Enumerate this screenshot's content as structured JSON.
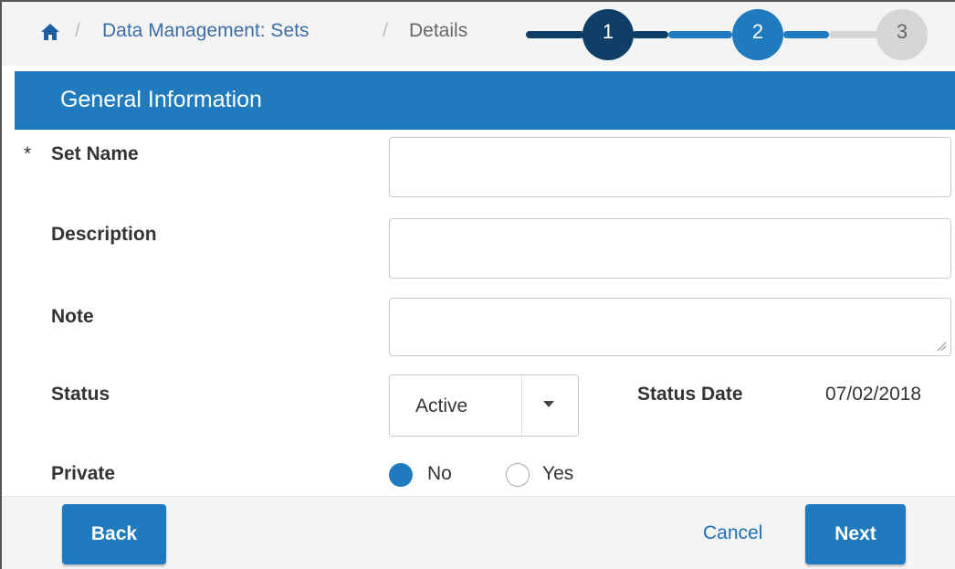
{
  "breadcrumb": {
    "items": [
      "Data Management: Sets",
      "Details"
    ],
    "separator": "/"
  },
  "stepper": {
    "steps": [
      "1",
      "2",
      "3"
    ],
    "current_step": 2,
    "colors": {
      "completed": "#0f3f66",
      "current": "#1f7bbd",
      "pending": "#d6d6d6"
    }
  },
  "section": {
    "title": "General Information"
  },
  "form": {
    "set_name": {
      "label": "Set Name",
      "required_mark": "*",
      "value": ""
    },
    "description": {
      "label": "Description",
      "value": ""
    },
    "note": {
      "label": "Note",
      "value": ""
    },
    "status": {
      "label": "Status",
      "selected": "Active"
    },
    "status_date": {
      "label": "Status Date",
      "value": "07/02/2018"
    },
    "private": {
      "label": "Private",
      "options": [
        "No",
        "Yes"
      ],
      "selected": "No"
    }
  },
  "footer": {
    "back_label": "Back",
    "cancel_label": "Cancel",
    "next_label": "Next"
  },
  "colors": {
    "accent": "#1f7bbd",
    "link": "#3a6ea8"
  }
}
